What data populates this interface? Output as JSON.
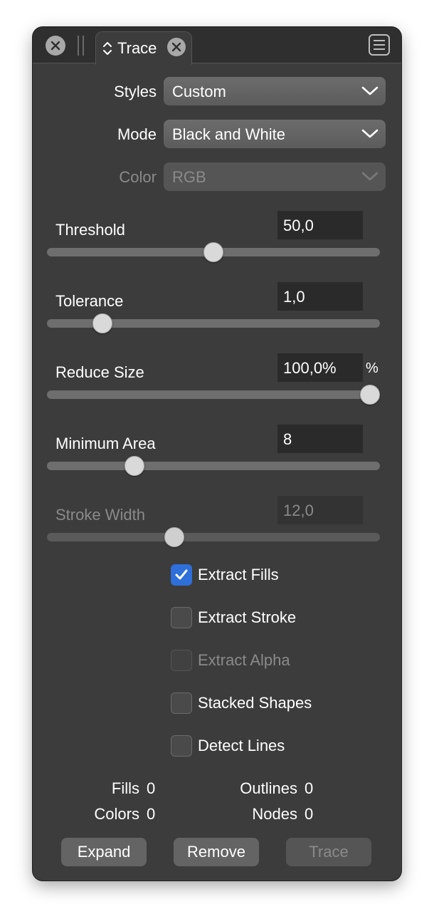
{
  "tab": {
    "title": "Trace"
  },
  "options": {
    "styles": {
      "label": "Styles",
      "value": "Custom"
    },
    "mode": {
      "label": "Mode",
      "value": "Black and White"
    },
    "color": {
      "label": "Color",
      "value": "RGB"
    }
  },
  "sliders": {
    "threshold": {
      "label": "Threshold",
      "value": "50,0",
      "level": 0.5
    },
    "tolerance": {
      "label": "Tolerance",
      "value": "1,0",
      "level": 0.146
    },
    "reduce_size": {
      "label": "Reduce Size",
      "value": "100,0%",
      "unit": "%",
      "level": 1.0
    },
    "minimum_area": {
      "label": "Minimum Area",
      "value": "8",
      "level": 0.248
    },
    "stroke_width": {
      "label": "Stroke Width",
      "value": "12,0",
      "level": 0.374
    }
  },
  "checkboxes": {
    "extract_fills": {
      "label": "Extract Fills",
      "checked": true
    },
    "extract_stroke": {
      "label": "Extract Stroke",
      "checked": false
    },
    "extract_alpha": {
      "label": "Extract Alpha",
      "checked": false
    },
    "stacked_shapes": {
      "label": "Stacked Shapes",
      "checked": false
    },
    "detect_lines": {
      "label": "Detect Lines",
      "checked": false
    }
  },
  "stats": {
    "fills": {
      "label": "Fills",
      "value": "0"
    },
    "outlines": {
      "label": "Outlines",
      "value": "0"
    },
    "colors": {
      "label": "Colors",
      "value": "0"
    },
    "nodes": {
      "label": "Nodes",
      "value": "0"
    }
  },
  "buttons": {
    "expand": "Expand",
    "remove": "Remove",
    "trace": "Trace"
  },
  "colors": {
    "panel_bg": "#3c3c3c",
    "accent": "#2e6fd9"
  }
}
